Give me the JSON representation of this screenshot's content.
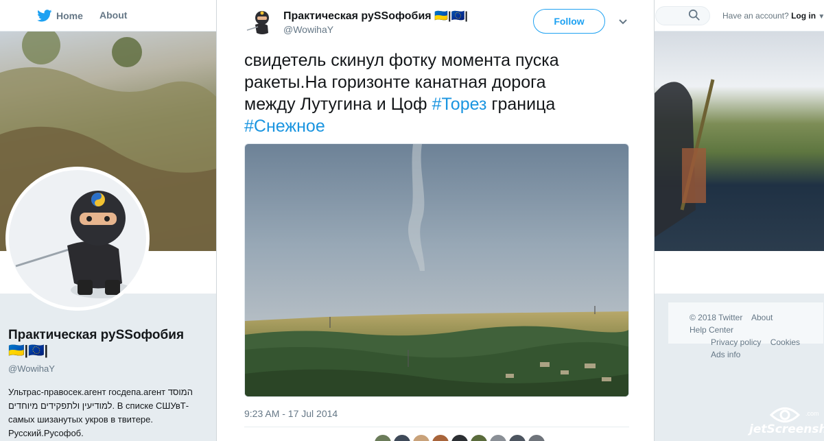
{
  "nav": {
    "home_label": "Home",
    "about_label": "About",
    "have_account_text": "Have an account?",
    "login_label": "Log in"
  },
  "profile": {
    "name": "Практическая руSSофобия",
    "flags": "🇺🇦|🇪🇺|",
    "handle": "@WowihaY",
    "bio_line1": "Ультрас-правосек.агент госдепа.агент המוסד",
    "bio_line2": "למודיעין ולתפקידים מיוחדים. В списке СШУвТ-",
    "bio_line3": "самых шизанутых укров в твитере.",
    "bio_line4": "Русский.Русофоб."
  },
  "footer": {
    "copyright": "© 2018 Twitter",
    "about": "About",
    "help_center": "Help Center",
    "privacy": "Privacy policy",
    "cookies": "Cookies",
    "ads": "Ads info"
  },
  "tweet": {
    "author_name": "Практическая руSSофобия",
    "author_flags": "🇺🇦|🇪🇺|",
    "author_handle": "@WowihaY",
    "follow_label": "Follow",
    "text_main": "свидетель скинул фотку момента пуска ракеты.На горизонте канатная дорога между Лутугина и Цоф ",
    "hashtag1": "#Торез",
    "text_mid": " граница ",
    "hashtag2": "#Снежное",
    "timestamp": "9:23 AM - 17 Jul 2014"
  },
  "watermark": {
    "text": "jetScreenshot",
    "suffix": ".com"
  },
  "colors": {
    "accent": "#1da1f2",
    "hashtag": "#1b95e0",
    "muted": "#657786"
  }
}
